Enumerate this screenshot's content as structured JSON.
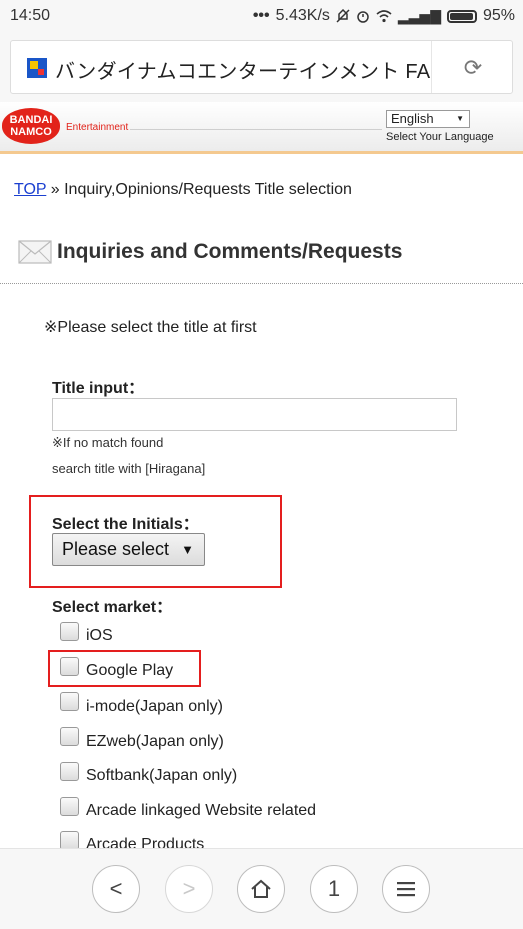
{
  "status_bar": {
    "time": "14:50",
    "network_speed": "5.43K/s",
    "battery": "95%"
  },
  "browser": {
    "page_title": "バンダイナムコエンターテインメント FAQ",
    "reload_icon": "reload-icon"
  },
  "site_header": {
    "logo_top": "BANDAI",
    "logo_bottom": "NAMCO",
    "logo_sub": "Entertainment",
    "language_selected": "English",
    "language_hint": "Select Your Language"
  },
  "breadcrumb": {
    "link": "TOP",
    "rest": " » Inquiry,Opinions/Requests Title selection"
  },
  "page": {
    "title": "Inquiries and Comments/Requests",
    "notice": "※Please select the title at first"
  },
  "form": {
    "title_input_label": "Title input：",
    "title_input_value": "",
    "hint_line1": "※If no match found",
    "hint_line2": "search title with [Hiragana]",
    "initials_label": "Select the Initials：",
    "initials_selected": "Please select",
    "market_label": "Select market：",
    "markets": [
      {
        "label": "iOS",
        "checked": false
      },
      {
        "label": "Google Play",
        "checked": false
      },
      {
        "label": "i-mode(Japan only)",
        "checked": false
      },
      {
        "label": "EZweb(Japan only)",
        "checked": false
      },
      {
        "label": "Softbank(Japan only)",
        "checked": false
      },
      {
        "label": "Arcade linkaged Website related",
        "checked": false
      },
      {
        "label": "Arcade Products",
        "checked": false
      }
    ]
  },
  "bottom_nav": {
    "back_icon": "<",
    "forward_icon": ">",
    "tabs_count": "1"
  },
  "colors": {
    "highlight_red": "#e41e1e",
    "link_blue": "#1a3fd0",
    "brand_red": "#e2231a"
  }
}
